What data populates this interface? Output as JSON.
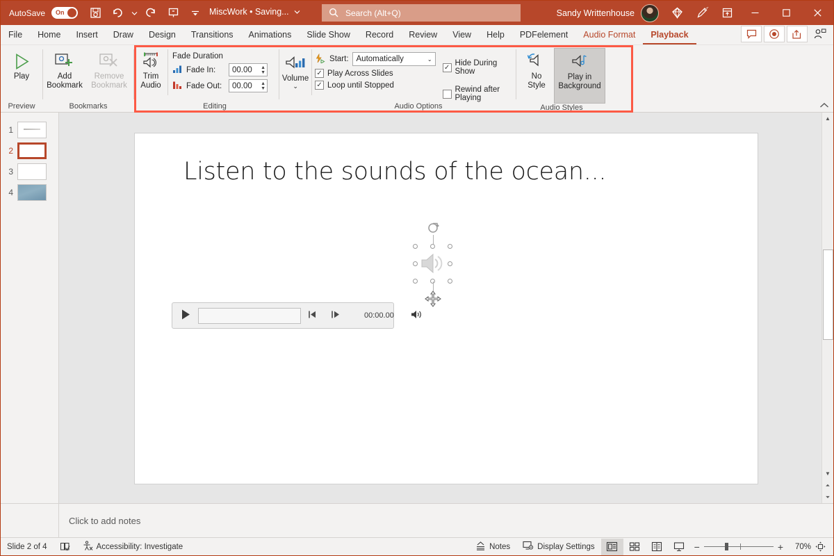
{
  "titlebar": {
    "autosave_label": "AutoSave",
    "autosave_state": "On",
    "doc_title": "MiscWork • Saving...",
    "user_name": "Sandy Writtenhouse",
    "icons": [
      "save-icon",
      "undo-icon",
      "undo-dropdown-icon",
      "redo-icon",
      "start-presentation-icon",
      "customize-quick-access-icon"
    ],
    "window_buttons": [
      "minimize",
      "maximize",
      "close"
    ]
  },
  "search": {
    "placeholder": "Search (Alt+Q)"
  },
  "tabs": [
    {
      "label": "File",
      "state": "normal"
    },
    {
      "label": "Home",
      "state": "normal"
    },
    {
      "label": "Insert",
      "state": "normal"
    },
    {
      "label": "Draw",
      "state": "normal"
    },
    {
      "label": "Design",
      "state": "normal"
    },
    {
      "label": "Transitions",
      "state": "normal"
    },
    {
      "label": "Animations",
      "state": "normal"
    },
    {
      "label": "Slide Show",
      "state": "normal"
    },
    {
      "label": "Record",
      "state": "normal"
    },
    {
      "label": "Review",
      "state": "normal"
    },
    {
      "label": "View",
      "state": "normal"
    },
    {
      "label": "Help",
      "state": "normal"
    },
    {
      "label": "PDFelement",
      "state": "normal"
    },
    {
      "label": "Audio Format",
      "state": "contextual"
    },
    {
      "label": "Playback",
      "state": "active"
    }
  ],
  "ribbon": {
    "preview": {
      "group_label": "Preview",
      "play_label": "Play"
    },
    "bookmarks": {
      "group_label": "Bookmarks",
      "add_label": "Add\nBookmark",
      "add_line1": "Add",
      "add_line2": "Bookmark",
      "remove_line1": "Remove",
      "remove_line2": "Bookmark"
    },
    "editing": {
      "group_label": "Editing",
      "trim_line1": "Trim",
      "trim_line2": "Audio",
      "fade_duration_label": "Fade Duration",
      "fade_in_label": "Fade In:",
      "fade_in_value": "00.00",
      "fade_out_label": "Fade Out:",
      "fade_out_value": "00.00"
    },
    "audio_options": {
      "group_label": "Audio Options",
      "volume_label": "Volume",
      "start_label": "Start:",
      "start_value": "Automatically",
      "play_across_slides": "Play Across Slides",
      "play_across_slides_checked": true,
      "loop_until_stopped": "Loop until Stopped",
      "loop_until_stopped_checked": true,
      "hide_during_show": "Hide During Show",
      "hide_during_show_checked": true,
      "rewind_after_playing": "Rewind after Playing",
      "rewind_after_playing_checked": false
    },
    "audio_styles": {
      "group_label": "Audio Styles",
      "no_style_line1": "No",
      "no_style_line2": "Style",
      "play_bg_line1": "Play in",
      "play_bg_line2": "Background",
      "play_bg_selected": true
    },
    "highlight_color": "#fc5a45",
    "collapse_icon": "chevron-up-icon"
  },
  "thumbnails": [
    {
      "number": "1",
      "selected": false,
      "kind": "text"
    },
    {
      "number": "2",
      "selected": true,
      "kind": "blank"
    },
    {
      "number": "3",
      "selected": false,
      "kind": "blank"
    },
    {
      "number": "4",
      "selected": false,
      "kind": "photo"
    }
  ],
  "slide": {
    "title": "Listen to the sounds of the ocean...",
    "audio_icon": "speaker-icon",
    "player": {
      "play_icon": "play-icon",
      "back_icon": "step-back-icon",
      "forward_icon": "step-forward-icon",
      "time": "00:00.00",
      "volume_icon": "volume-icon"
    }
  },
  "notes": {
    "placeholder": "Click to add notes"
  },
  "status": {
    "slide_counter": "Slide 2 of 4",
    "language_icon": "spellcheck-icon",
    "accessibility": "Accessibility: Investigate",
    "notes_label": "Notes",
    "display_settings_label": "Display Settings",
    "views": [
      "normal-view",
      "slide-sorter-view",
      "reading-view",
      "slide-show-view"
    ],
    "active_view": "normal-view",
    "zoom_out": "−",
    "zoom_in": "+",
    "zoom_value": "70%",
    "fit_icon": "fit-to-window-icon"
  },
  "colors": {
    "brand": "#b7472a",
    "highlight": "#fc5a45",
    "ribbon_bg": "#f3f2f1"
  }
}
